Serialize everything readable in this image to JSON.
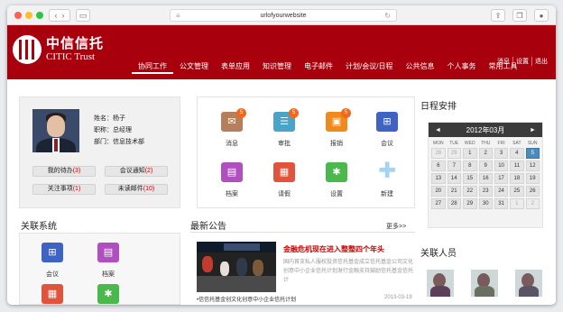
{
  "browser": {
    "url": "urlofyourwebsite"
  },
  "brand": {
    "name_cn": "中信信托",
    "name_en": "CITIC Trust"
  },
  "toplinks": [
    "消息",
    "设置",
    "退出"
  ],
  "menu": [
    "协同工作",
    "公文管理",
    "表单应用",
    "知识管理",
    "电子邮件",
    "计划/会议/日程",
    "公共信息",
    "个人事务",
    "常用工具"
  ],
  "profile": {
    "name": "姓名：杨子",
    "title": "职称：总经理",
    "dept": "部门：信息技术部",
    "buttons": [
      {
        "label": "我的待办",
        "count": "(3)"
      },
      {
        "label": "会议通知",
        "count": "(2)"
      },
      {
        "label": "关注事项",
        "count": "(1)"
      },
      {
        "label": "未读邮件",
        "count": "(10)"
      }
    ]
  },
  "apps": [
    {
      "label": "消息",
      "icon": "message-icon",
      "color": "#b57f5c",
      "badge": "5"
    },
    {
      "label": "审批",
      "icon": "approval-icon",
      "color": "#4aa3c9",
      "badge": "5"
    },
    {
      "label": "报销",
      "icon": "reimburse-icon",
      "color": "#f08a1d",
      "badge": "5"
    },
    {
      "label": "会议",
      "icon": "meeting-icon",
      "color": "#3e63c4",
      "badge": ""
    },
    {
      "label": "档案",
      "icon": "archive-icon",
      "color": "#b04fc0",
      "badge": ""
    },
    {
      "label": "请假",
      "icon": "leave-icon",
      "color": "#e0533c",
      "badge": ""
    },
    {
      "label": "设置",
      "icon": "settings-icon",
      "color": "#4bb84c",
      "badge": ""
    },
    {
      "label": "新建",
      "icon": "plus-icon",
      "color": "#a6d3ef",
      "badge": ""
    }
  ],
  "related_systems": {
    "title": "关联系统",
    "items": [
      {
        "label": "会议",
        "icon": "meeting-icon",
        "color": "#3e63c4"
      },
      {
        "label": "档案",
        "icon": "archive-icon",
        "color": "#b04fc0"
      },
      {
        "label": "",
        "icon": "leave-icon",
        "color": "#e0533c"
      },
      {
        "label": "",
        "icon": "settings-icon",
        "color": "#4bb84c"
      }
    ]
  },
  "schedule": {
    "title": "日程安排",
    "month": "2012年03月",
    "prev": "◄",
    "next": "►",
    "weekdays": [
      "MON",
      "TUE",
      "WED",
      "THU",
      "FRI",
      "SAT",
      "SUN"
    ],
    "weeks": [
      [
        "28",
        "29",
        "1",
        "2",
        "3",
        "4",
        "5"
      ],
      [
        "6",
        "7",
        "8",
        "9",
        "10",
        "11",
        "12"
      ],
      [
        "13",
        "14",
        "15",
        "16",
        "17",
        "18",
        "19"
      ],
      [
        "20",
        "21",
        "22",
        "23",
        "24",
        "25",
        "26"
      ],
      [
        "27",
        "28",
        "29",
        "30",
        "31",
        "1",
        "2"
      ]
    ],
    "today": "5"
  },
  "announcements": {
    "title": "最新公告",
    "more": "更多>>",
    "headline": "金融危机现在进入整整四个年头",
    "summary": "国内首支私人服权投资信托基金成立信托基金公司文化创意中小企业信托计划发行金融支持鼓励信托基金信托计",
    "list_item": "•信信托基金创文化创意中小企业信托计划",
    "list_date": "2013-03-19"
  },
  "related_people": {
    "title": "关联人员",
    "count": 3
  }
}
